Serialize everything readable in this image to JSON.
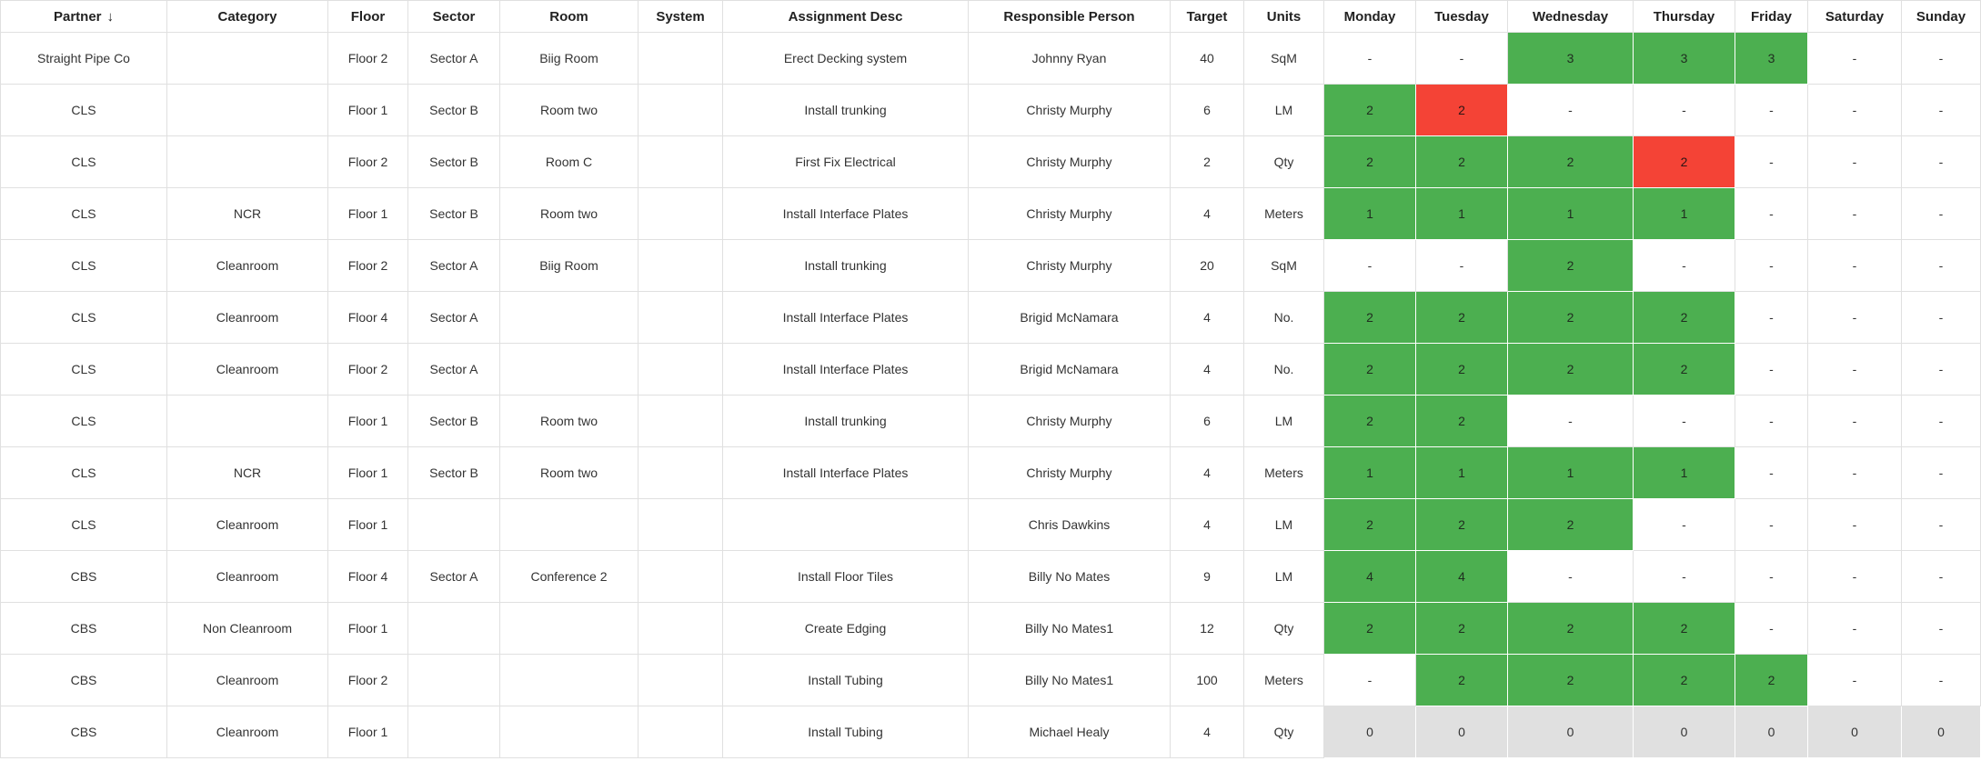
{
  "table": {
    "columns": [
      "Partner",
      "Category",
      "Floor",
      "Sector",
      "Room",
      "System",
      "Assignment Desc",
      "Responsible Person",
      "Target",
      "Units",
      "Monday",
      "Tuesday",
      "Wednesday",
      "Thursday",
      "Friday",
      "Saturday",
      "Sunday"
    ],
    "sort_icon": "↓",
    "rows": [
      {
        "cells": [
          "Straight Pipe Co",
          "",
          "Floor 2",
          "Sector A",
          "Biig Room",
          "",
          "Erect Decking system",
          "Johnny Ryan",
          "40",
          "SqM"
        ],
        "days": [
          [
            "-",
            ""
          ],
          [
            "-",
            ""
          ],
          [
            "3",
            "green"
          ],
          [
            "3",
            "green"
          ],
          [
            "3",
            "green"
          ],
          [
            "-",
            ""
          ],
          [
            "-",
            ""
          ]
        ]
      },
      {
        "cells": [
          "CLS",
          "",
          "Floor 1",
          "Sector B",
          "Room two",
          "",
          "Install trunking",
          "Christy Murphy",
          "6",
          "LM"
        ],
        "days": [
          [
            "2",
            "green"
          ],
          [
            "2",
            "red"
          ],
          [
            "-",
            ""
          ],
          [
            "-",
            ""
          ],
          [
            "-",
            ""
          ],
          [
            "-",
            ""
          ],
          [
            "-",
            ""
          ]
        ]
      },
      {
        "cells": [
          "CLS",
          "",
          "Floor 2",
          "Sector B",
          "Room C",
          "",
          "First Fix Electrical",
          "Christy Murphy",
          "2",
          "Qty"
        ],
        "days": [
          [
            "2",
            "green"
          ],
          [
            "2",
            "green"
          ],
          [
            "2",
            "green"
          ],
          [
            "2",
            "red"
          ],
          [
            "-",
            ""
          ],
          [
            "-",
            ""
          ],
          [
            "-",
            ""
          ]
        ]
      },
      {
        "cells": [
          "CLS",
          "NCR",
          "Floor 1",
          "Sector B",
          "Room two",
          "",
          "Install Interface Plates",
          "Christy Murphy",
          "4",
          "Meters"
        ],
        "days": [
          [
            "1",
            "green"
          ],
          [
            "1",
            "green"
          ],
          [
            "1",
            "green"
          ],
          [
            "1",
            "green"
          ],
          [
            "-",
            ""
          ],
          [
            "-",
            ""
          ],
          [
            "-",
            ""
          ]
        ]
      },
      {
        "cells": [
          "CLS",
          "Cleanroom",
          "Floor 2",
          "Sector A",
          "Biig Room",
          "",
          "Install trunking",
          "Christy Murphy",
          "20",
          "SqM"
        ],
        "days": [
          [
            "-",
            ""
          ],
          [
            "-",
            ""
          ],
          [
            "2",
            "green"
          ],
          [
            "-",
            ""
          ],
          [
            "-",
            ""
          ],
          [
            "-",
            ""
          ],
          [
            "-",
            ""
          ]
        ]
      },
      {
        "cells": [
          "CLS",
          "Cleanroom",
          "Floor 4",
          "Sector A",
          "",
          "",
          "Install Interface Plates",
          "Brigid McNamara",
          "4",
          "No."
        ],
        "days": [
          [
            "2",
            "green"
          ],
          [
            "2",
            "green"
          ],
          [
            "2",
            "green"
          ],
          [
            "2",
            "green"
          ],
          [
            "-",
            ""
          ],
          [
            "-",
            ""
          ],
          [
            "-",
            ""
          ]
        ]
      },
      {
        "cells": [
          "CLS",
          "Cleanroom",
          "Floor 2",
          "Sector A",
          "",
          "",
          "Install Interface Plates",
          "Brigid McNamara",
          "4",
          "No."
        ],
        "days": [
          [
            "2",
            "green"
          ],
          [
            "2",
            "green"
          ],
          [
            "2",
            "green"
          ],
          [
            "2",
            "green"
          ],
          [
            "-",
            ""
          ],
          [
            "-",
            ""
          ],
          [
            "-",
            ""
          ]
        ]
      },
      {
        "cells": [
          "CLS",
          "",
          "Floor 1",
          "Sector B",
          "Room two",
          "",
          "Install trunking",
          "Christy Murphy",
          "6",
          "LM"
        ],
        "days": [
          [
            "2",
            "green"
          ],
          [
            "2",
            "green"
          ],
          [
            "-",
            ""
          ],
          [
            "-",
            ""
          ],
          [
            "-",
            ""
          ],
          [
            "-",
            ""
          ],
          [
            "-",
            ""
          ]
        ]
      },
      {
        "cells": [
          "CLS",
          "NCR",
          "Floor 1",
          "Sector B",
          "Room two",
          "",
          "Install Interface Plates",
          "Christy Murphy",
          "4",
          "Meters"
        ],
        "days": [
          [
            "1",
            "green"
          ],
          [
            "1",
            "green"
          ],
          [
            "1",
            "green"
          ],
          [
            "1",
            "green"
          ],
          [
            "-",
            ""
          ],
          [
            "-",
            ""
          ],
          [
            "-",
            ""
          ]
        ]
      },
      {
        "cells": [
          "CLS",
          "Cleanroom",
          "Floor 1",
          "",
          "",
          "",
          "",
          "Chris Dawkins",
          "4",
          "LM"
        ],
        "days": [
          [
            "2",
            "green"
          ],
          [
            "2",
            "green"
          ],
          [
            "2",
            "green"
          ],
          [
            "-",
            ""
          ],
          [
            "-",
            ""
          ],
          [
            "-",
            ""
          ],
          [
            "-",
            ""
          ]
        ]
      },
      {
        "cells": [
          "CBS",
          "Cleanroom",
          "Floor 4",
          "Sector A",
          "Conference 2",
          "",
          "Install Floor Tiles",
          "Billy No Mates",
          "9",
          "LM"
        ],
        "days": [
          [
            "4",
            "green"
          ],
          [
            "4",
            "green"
          ],
          [
            "-",
            ""
          ],
          [
            "-",
            ""
          ],
          [
            "-",
            ""
          ],
          [
            "-",
            ""
          ],
          [
            "-",
            ""
          ]
        ]
      },
      {
        "cells": [
          "CBS",
          "Non Cleanroom",
          "Floor 1",
          "",
          "",
          "",
          "Create Edging",
          "Billy No Mates1",
          "12",
          "Qty"
        ],
        "days": [
          [
            "2",
            "green"
          ],
          [
            "2",
            "green"
          ],
          [
            "2",
            "green"
          ],
          [
            "2",
            "green"
          ],
          [
            "-",
            ""
          ],
          [
            "-",
            ""
          ],
          [
            "-",
            ""
          ]
        ]
      },
      {
        "cells": [
          "CBS",
          "Cleanroom",
          "Floor 2",
          "",
          "",
          "",
          "Install Tubing",
          "Billy No Mates1",
          "100",
          "Meters"
        ],
        "days": [
          [
            "-",
            ""
          ],
          [
            "2",
            "green"
          ],
          [
            "2",
            "green"
          ],
          [
            "2",
            "green"
          ],
          [
            "2",
            "green"
          ],
          [
            "-",
            ""
          ],
          [
            "-",
            ""
          ]
        ]
      },
      {
        "cells": [
          "CBS",
          "Cleanroom",
          "Floor 1",
          "",
          "",
          "",
          "Install Tubing",
          "Michael Healy",
          "4",
          "Qty"
        ],
        "days": [
          [
            "0",
            "grey"
          ],
          [
            "0",
            "grey"
          ],
          [
            "0",
            "grey"
          ],
          [
            "0",
            "grey"
          ],
          [
            "0",
            "grey"
          ],
          [
            "0",
            "grey"
          ],
          [
            "0",
            "grey"
          ]
        ]
      }
    ]
  },
  "colors": {
    "green": "#4caf50",
    "red": "#f44336",
    "grey": "#e0e0e0"
  }
}
